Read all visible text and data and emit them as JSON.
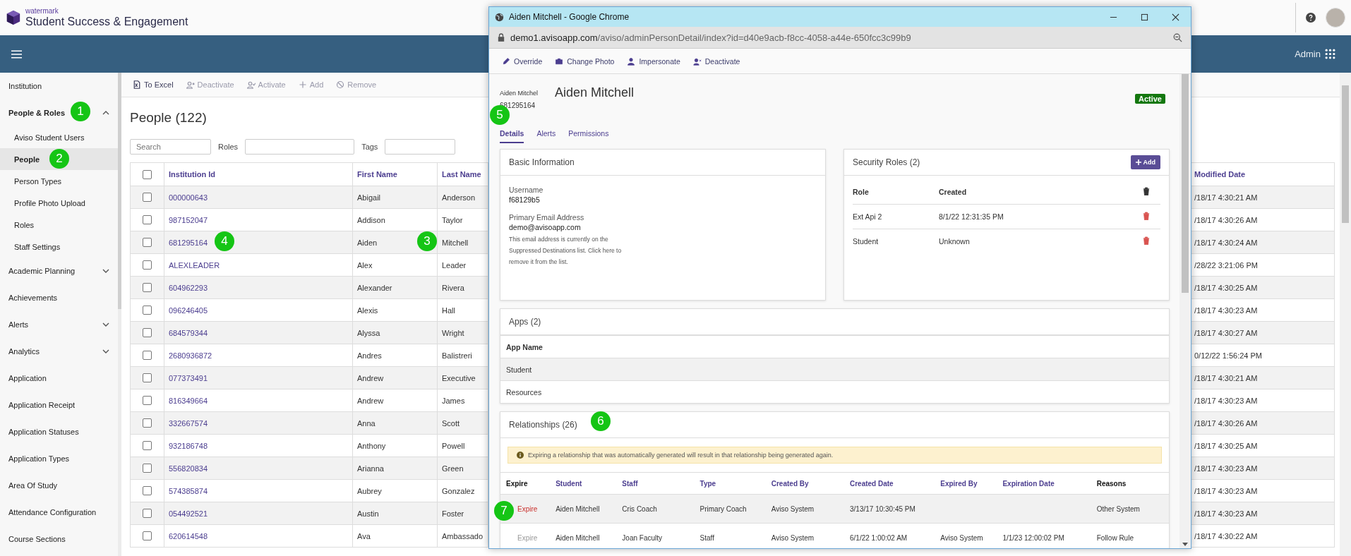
{
  "header": {
    "company": "watermark",
    "product": "Student Success & Engagement"
  },
  "nav_bar": {
    "user": "Admin"
  },
  "sidebar": {
    "items": [
      {
        "kind": "link",
        "label": "Institution",
        "selected": false
      },
      {
        "kind": "group",
        "label": "People & Roles",
        "expanded": true,
        "selected": false,
        "children": [
          {
            "label": "Aviso Student Users",
            "selected": false
          },
          {
            "label": "People",
            "selected": true
          },
          {
            "label": "Person Types",
            "selected": false
          },
          {
            "label": "Profile Photo Upload",
            "selected": false
          },
          {
            "label": "Roles",
            "selected": false
          },
          {
            "label": "Staff Settings",
            "selected": false
          }
        ]
      },
      {
        "kind": "group",
        "label": "Academic Planning",
        "expanded": false,
        "selected": false
      },
      {
        "kind": "link",
        "label": "Achievements",
        "selected": false
      },
      {
        "kind": "group",
        "label": "Alerts",
        "expanded": false,
        "selected": false
      },
      {
        "kind": "group",
        "label": "Analytics",
        "expanded": false,
        "selected": false
      },
      {
        "kind": "link",
        "label": "Application",
        "selected": false
      },
      {
        "kind": "link",
        "label": "Application Receipt",
        "selected": false
      },
      {
        "kind": "link",
        "label": "Application Statuses",
        "selected": false
      },
      {
        "kind": "link",
        "label": "Application Types",
        "selected": false
      },
      {
        "kind": "link",
        "label": "Area Of Study",
        "selected": false
      },
      {
        "kind": "link",
        "label": "Attendance Configuration",
        "selected": false
      },
      {
        "kind": "link",
        "label": "Course Sections",
        "selected": false
      }
    ]
  },
  "toolbar": [
    {
      "label": "To Excel",
      "disabled": false
    },
    {
      "label": "Deactivate",
      "disabled": true
    },
    {
      "label": "Activate",
      "disabled": true
    },
    {
      "label": "Add",
      "disabled": true
    },
    {
      "label": "Remove",
      "disabled": true
    }
  ],
  "page_title": "People (122)",
  "filters": {
    "search_placeholder": "Search",
    "roles_label": "Roles",
    "tags_label": "Tags"
  },
  "table": {
    "select_all_checked": false,
    "columns": [
      "Institution Id",
      "First Name",
      "Last Name",
      "Modified Date"
    ],
    "rows": [
      {
        "checked": false,
        "institution_id": "000000643",
        "first_name": "Abigail",
        "last_name": "Anderson",
        "modified_date": "/18/17 4:30:21 AM"
      },
      {
        "checked": false,
        "institution_id": "987152047",
        "first_name": "Addison",
        "last_name": "Taylor",
        "modified_date": "/18/17 4:30:26 AM"
      },
      {
        "checked": false,
        "institution_id": "681295164",
        "first_name": "Aiden",
        "last_name": "Mitchell",
        "modified_date": "/18/17 4:30:24 AM"
      },
      {
        "checked": false,
        "institution_id": "ALEXLEADER",
        "first_name": "Alex",
        "last_name": "Leader",
        "modified_date": "/28/22 3:21:06 PM"
      },
      {
        "checked": false,
        "institution_id": "604962293",
        "first_name": "Alexander",
        "last_name": "Rivera",
        "modified_date": "/18/17 4:30:25 AM"
      },
      {
        "checked": false,
        "institution_id": "096246405",
        "first_name": "Alexis",
        "last_name": "Hall",
        "modified_date": "/18/17 4:30:23 AM"
      },
      {
        "checked": false,
        "institution_id": "684579344",
        "first_name": "Alyssa",
        "last_name": "Wright",
        "modified_date": "/18/17 4:30:27 AM"
      },
      {
        "checked": false,
        "institution_id": "2680936872",
        "first_name": "Andres",
        "last_name": "Balistreri",
        "modified_date": "0/12/22 1:56:24 PM"
      },
      {
        "checked": false,
        "institution_id": "077373491",
        "first_name": "Andrew",
        "last_name": "Executive",
        "modified_date": "/18/17 4:30:21 AM"
      },
      {
        "checked": false,
        "institution_id": "816349664",
        "first_name": "Andrew",
        "last_name": "James",
        "modified_date": "/18/17 4:30:23 AM"
      },
      {
        "checked": false,
        "institution_id": "332667574",
        "first_name": "Anna",
        "last_name": "Scott",
        "modified_date": "/18/17 4:30:26 AM"
      },
      {
        "checked": false,
        "institution_id": "932186748",
        "first_name": "Anthony",
        "last_name": "Powell",
        "modified_date": "/18/17 4:30:25 AM"
      },
      {
        "checked": false,
        "institution_id": "556820834",
        "first_name": "Arianna",
        "last_name": "Green",
        "modified_date": "/18/17 4:30:23 AM"
      },
      {
        "checked": false,
        "institution_id": "574385874",
        "first_name": "Aubrey",
        "last_name": "Gonzalez",
        "modified_date": "/18/17 4:30:23 AM"
      },
      {
        "checked": false,
        "institution_id": "054492521",
        "first_name": "Austin",
        "last_name": "Foster",
        "modified_date": "/18/17 4:30:23 AM"
      },
      {
        "checked": false,
        "institution_id": "620614548",
        "first_name": "Ava",
        "last_name": "Ambassado",
        "modified_date": "/18/17 4:30:22 AM"
      }
    ]
  },
  "popup": {
    "window_title": "Aiden Mitchell - Google Chrome",
    "url_domain": "demo1.avisoapp.com",
    "url_path": "/aviso/adminPersonDetail/index?id=d40e9acb-f8cc-4058-a44e-650fcc3c99b9",
    "actions": [
      "Override",
      "Change Photo",
      "Impersonate",
      "Deactivate"
    ],
    "photo_alt": "Aiden Mitchel",
    "name": "Aiden Mitchell",
    "person_id": "681295164",
    "status": "Active",
    "tabs": [
      {
        "label": "Details",
        "selected": true
      },
      {
        "label": "Alerts",
        "selected": false
      },
      {
        "label": "Permissions",
        "selected": false
      }
    ],
    "basic_info": {
      "title": "Basic Information",
      "fields": [
        {
          "label": "Username",
          "value": "f68129b5"
        },
        {
          "label": "Primary Email Address",
          "value": "demo@avisoapp.com"
        }
      ],
      "note": "This email address is currently on the Suppressed Destinations list. Click here to remove it from the list."
    },
    "security_roles": {
      "title": "Security Roles (2)",
      "add_button": "Add",
      "columns": [
        "Role",
        "Created"
      ],
      "rows": [
        {
          "role": "Ext Api 2",
          "created": "8/1/22 12:31:35 PM"
        },
        {
          "role": "Student",
          "created": "Unknown"
        }
      ]
    },
    "apps": {
      "title": "Apps (2)",
      "column": "App Name",
      "rows": [
        "Student",
        "Resources"
      ]
    },
    "relationships": {
      "title": "Relationships (26)",
      "notice": "Expiring a relationship that was automatically generated will result in that relationship being generated again.",
      "columns": [
        {
          "label": "Expire",
          "sortable": false
        },
        {
          "label": "Student",
          "sortable": true
        },
        {
          "label": "Staff",
          "sortable": true
        },
        {
          "label": "Type",
          "sortable": true
        },
        {
          "label": "Created By",
          "sortable": true
        },
        {
          "label": "Created Date",
          "sortable": true
        },
        {
          "label": "Expired By",
          "sortable": true
        },
        {
          "label": "Expiration Date",
          "sortable": true
        },
        {
          "label": "Reasons",
          "sortable": false
        }
      ],
      "rows": [
        {
          "enabled": true,
          "highlighted": true,
          "cells": [
            "Expire",
            "Aiden Mitchell",
            "Cris Coach",
            "Primary Coach",
            "Aviso System",
            "3/13/17 10:30:45 PM",
            "",
            "",
            "Other System"
          ]
        },
        {
          "enabled": false,
          "highlighted": false,
          "cells": [
            "Expire",
            "Aiden Mitchell",
            "Joan Faculty",
            "Staff",
            "Aviso System",
            "6/1/22 1:00:02 AM",
            "Aviso System",
            "1/1/23 12:00:02 PM",
            "Follow Rule"
          ]
        }
      ]
    }
  },
  "callouts": [
    "1",
    "2",
    "3",
    "4",
    "5",
    "6",
    "7"
  ]
}
